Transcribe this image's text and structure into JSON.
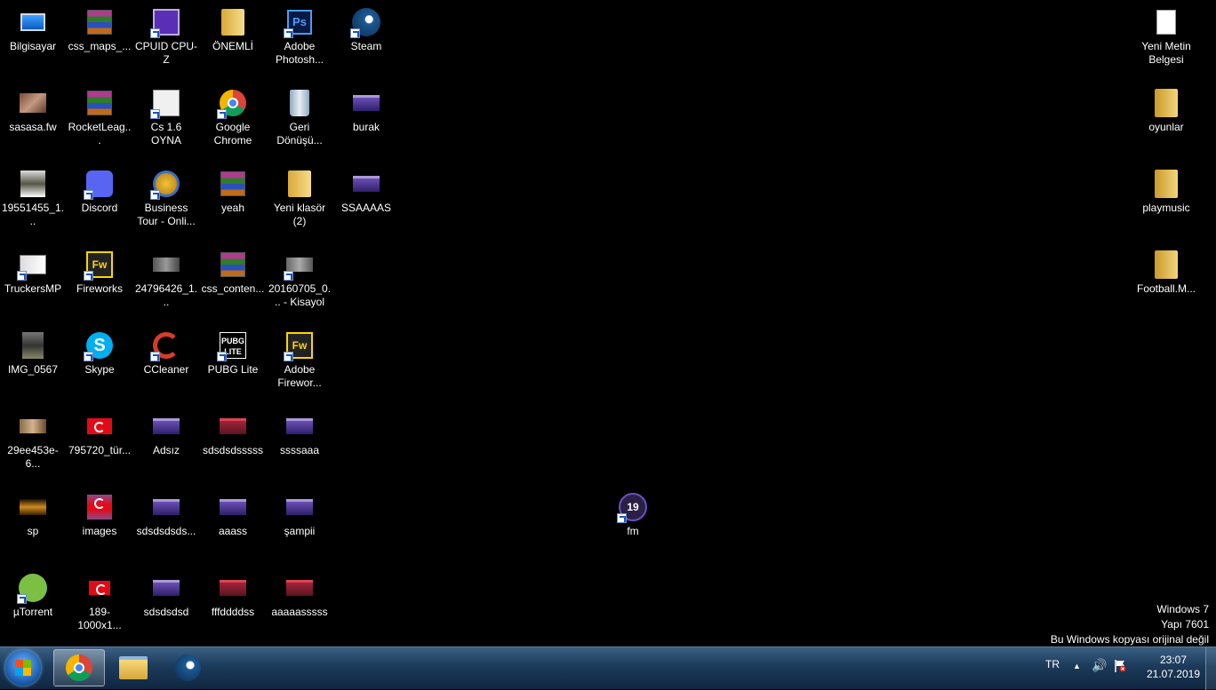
{
  "desktop": {
    "icons": [
      {
        "label": "Bilgisayar",
        "icon": "computer-icon"
      },
      {
        "label": "css_maps_...",
        "icon": "winrar-archive-icon"
      },
      {
        "label": "CPUID CPU-Z",
        "icon": "cpu-z-icon"
      },
      {
        "label": "ÖNEMLİ",
        "icon": "folder-icon"
      },
      {
        "label": "Adobe Photosh...",
        "icon": "photoshop-icon"
      },
      {
        "label": "Steam",
        "icon": "steam-icon"
      },
      {
        "label": "sasasa.fw",
        "icon": "image-file-icon"
      },
      {
        "label": "RocketLeag...",
        "icon": "winrar-archive-icon"
      },
      {
        "label": "Cs 1.6 OYNA",
        "icon": "counter-strike-icon"
      },
      {
        "label": "Google Chrome",
        "icon": "chrome-icon"
      },
      {
        "label": "Geri Dönüşü...",
        "icon": "recycle-bin-icon"
      },
      {
        "label": "burak",
        "icon": "image-file-icon"
      },
      {
        "label": "19551455_1...",
        "icon": "image-file-icon"
      },
      {
        "label": "Discord",
        "icon": "discord-icon"
      },
      {
        "label": "Business Tour - Onli...",
        "icon": "business-tour-icon"
      },
      {
        "label": "yeah",
        "icon": "winrar-archive-icon"
      },
      {
        "label": "Yeni klasör (2)",
        "icon": "folder-icon"
      },
      {
        "label": "SSAAAAS",
        "icon": "image-file-icon"
      },
      {
        "label": "TruckersMP",
        "icon": "truckersmp-icon"
      },
      {
        "label": "Fireworks",
        "icon": "fireworks-icon"
      },
      {
        "label": "24796426_1...",
        "icon": "image-file-icon"
      },
      {
        "label": "css_conten...",
        "icon": "winrar-archive-icon"
      },
      {
        "label": "20160705_0... - Kisayol",
        "icon": "image-file-icon"
      },
      {
        "label": "IMG_0567",
        "icon": "image-file-icon"
      },
      {
        "label": "Skype",
        "icon": "skype-icon"
      },
      {
        "label": "CCleaner",
        "icon": "ccleaner-icon"
      },
      {
        "label": "PUBG Lite",
        "icon": "pubg-icon"
      },
      {
        "label": "Adobe Firewor...",
        "icon": "fireworks-icon"
      },
      {
        "label": "29ee453e-6...",
        "icon": "image-file-icon"
      },
      {
        "label": "795720_tür...",
        "icon": "turkish-flag-image-icon"
      },
      {
        "label": "Adsız",
        "icon": "image-file-icon"
      },
      {
        "label": "sdsdsdsssss",
        "icon": "image-file-icon"
      },
      {
        "label": "ssssaaa",
        "icon": "image-file-icon"
      },
      {
        "label": "sp",
        "icon": "image-file-icon"
      },
      {
        "label": "images",
        "icon": "turkish-flag-image-icon"
      },
      {
        "label": "sdsdsdsds...",
        "icon": "image-file-icon"
      },
      {
        "label": "aaass",
        "icon": "image-file-icon"
      },
      {
        "label": "şampii",
        "icon": "image-file-icon"
      },
      {
        "label": "µTorrent",
        "icon": "utorrent-icon"
      },
      {
        "label": "189-1000x1...",
        "icon": "turkish-flag-image-icon"
      },
      {
        "label": "sdsdsdsd",
        "icon": "image-file-icon"
      },
      {
        "label": "fffddddss",
        "icon": "image-file-icon"
      },
      {
        "label": "aaaaasssss",
        "icon": "image-file-icon"
      },
      {
        "label": "fm",
        "icon": "football-manager-icon"
      },
      {
        "label": "Yeni Metin Belgesi",
        "icon": "text-document-icon"
      },
      {
        "label": "oyunlar",
        "icon": "folder-icon"
      },
      {
        "label": "playmusic",
        "icon": "folder-icon"
      },
      {
        "label": "Football.M...",
        "icon": "folder-icon"
      }
    ]
  },
  "watermark": {
    "line1": "Windows 7",
    "line2": "Yapı 7601",
    "line3": "Bu Windows kopyası orijinal değil"
  },
  "taskbar": {
    "start_icon": "windows-start-icon",
    "pinned": [
      "chrome-icon",
      "windows-explorer-icon",
      "steam-icon"
    ],
    "language": "TR",
    "time": "23:07",
    "date": "21.07.2019"
  },
  "colors": {
    "desktop_background": "#000000",
    "taskbar": "#1c3a5a"
  }
}
